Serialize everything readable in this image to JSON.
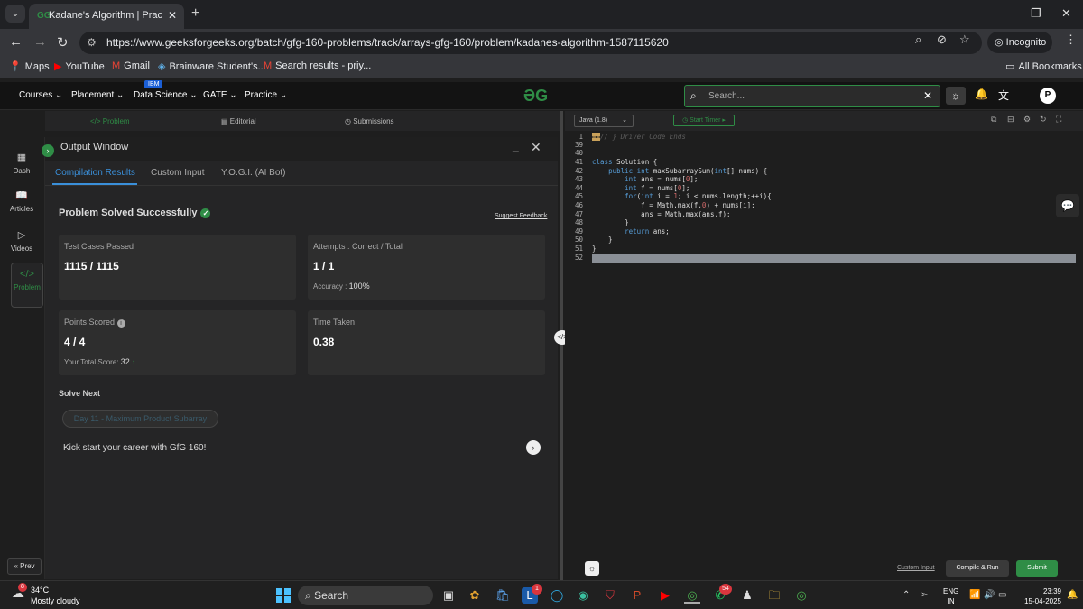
{
  "browser": {
    "tab_title": "Kadane's Algorithm | Practice | G",
    "tab_favicon": "GG",
    "url": "https://www.geeksforgeeks.org/batch/gfg-160-problems/track/arrays-gfg-160/problem/kadanes-algorithm-1587115620",
    "incognito_label": "Incognito",
    "bookmarks": [
      {
        "icon": "map-pin-icon",
        "glyph": "📍",
        "label": "Maps"
      },
      {
        "icon": "youtube-icon",
        "glyph": "▶",
        "label": "YouTube"
      },
      {
        "icon": "gmail-icon",
        "glyph": "M",
        "label": "Gmail"
      },
      {
        "icon": "brainware-icon",
        "glyph": "◈",
        "label": "Brainware Student's..."
      },
      {
        "icon": "gmail-icon",
        "glyph": "M",
        "label": "Search results - priy..."
      }
    ],
    "all_bookmarks": "All Bookmarks"
  },
  "gfg_header": {
    "menu": [
      "Courses",
      "Placement",
      "Data Science",
      "GATE",
      "Practice"
    ],
    "ibm_badge": "IBM",
    "logo": "ƏG",
    "search_placeholder": "Search..."
  },
  "problem_tabs": [
    "Problem",
    "Editorial",
    "Submissions"
  ],
  "sidebar": {
    "items": [
      "Dash",
      "Articles",
      "Videos",
      "Problem"
    ],
    "prev_label": "Prev"
  },
  "output_window": {
    "title": "Output Window",
    "tabs": [
      "Compilation Results",
      "Custom Input",
      "Y.O.G.I. (AI Bot)"
    ],
    "status": "Problem Solved Successfully",
    "suggest_feedback": "Suggest Feedback",
    "cards": {
      "test_cases": {
        "label": "Test Cases Passed",
        "value": "1115 / 1115"
      },
      "attempts": {
        "label": "Attempts : Correct / Total",
        "value": "1 / 1",
        "sub_label": "Accuracy :",
        "sub_value": "100%"
      },
      "points": {
        "label": "Points Scored",
        "value": "4 / 4",
        "sub_label": "Your Total Score:",
        "sub_value": "32"
      },
      "time": {
        "label": "Time Taken",
        "value": "0.38"
      }
    },
    "solve_next_heading": "Solve Next",
    "next_problem": "Day 11 - Maximum Product Subarray",
    "promo": "Kick start your career with GfG 160!"
  },
  "editor": {
    "language": "Java (1.8)",
    "timer_label": "Start Timer",
    "line_numbers": [
      "1",
      "39",
      "40",
      "41",
      "42",
      "43",
      "44",
      "45",
      "46",
      "47",
      "48",
      "49",
      "50",
      "51",
      "52"
    ],
    "comment_line": "// } Driver Code Ends",
    "custom_input": "Custom Input",
    "compile_run": "Compile & Run",
    "submit": "Submit"
  },
  "taskbar": {
    "weather_temp": "34°C",
    "weather_desc": "Mostly cloudy",
    "weather_badge": "8",
    "search_label": "Search",
    "badge_l": "1",
    "badge_wa": "54",
    "lang_top": "ENG",
    "lang_bottom": "IN",
    "time": "23:39",
    "date": "15-04-2025"
  }
}
